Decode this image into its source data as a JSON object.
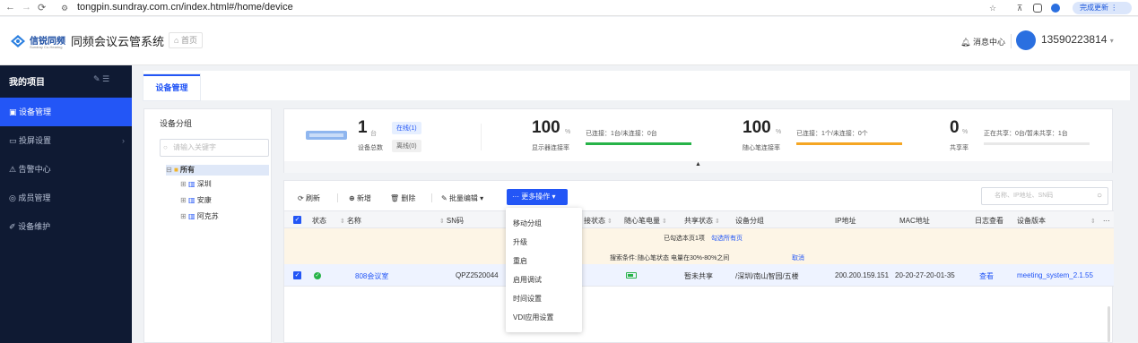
{
  "browser": {
    "url": "tongpin.sundray.com.cn/index.html#/home/device",
    "update_label": "完成更新"
  },
  "header": {
    "brand": "信锐同频",
    "brand_sub": "Sundray Co-Hearing",
    "system_title": "同频会议云管系统",
    "home_label": "首页",
    "message_center": "消息中心",
    "phone": "13590223814"
  },
  "sidebar": {
    "title": "我的项目",
    "items": [
      {
        "label": "设备管理",
        "icon": "device-icon"
      },
      {
        "label": "投屏设置",
        "icon": "screen-icon"
      },
      {
        "label": "告警中心",
        "icon": "bell-icon"
      },
      {
        "label": "成员管理",
        "icon": "member-icon"
      },
      {
        "label": "设备维护",
        "icon": "wrench-icon"
      }
    ]
  },
  "tabs": {
    "active": "设备管理"
  },
  "groups": {
    "title": "设备分组",
    "search_placeholder": "请输入关键字",
    "tree": {
      "root": "所有",
      "children": [
        "深圳",
        "安康",
        "阿克苏"
      ]
    }
  },
  "stats": {
    "device_count": "1",
    "device_unit": "台",
    "device_label": "设备总数",
    "online": "在线(1)",
    "offline": "离线(0)",
    "display": {
      "value": "100",
      "unit": "%",
      "label": "显示器连接率",
      "text": "已连接：1台/未连接：0台",
      "fill": 1.0,
      "color": "#27b348"
    },
    "pen": {
      "value": "100",
      "unit": "%",
      "label": "随心笔连接率",
      "text": "已连接：1个/未连接：0个",
      "fill": 1.0,
      "color": "#f5a623"
    },
    "share": {
      "value": "0",
      "unit": "%",
      "label": "共享率",
      "text": "正在共享：0台/暂未共享：1台",
      "fill": 0.0,
      "color": "#2356f6"
    }
  },
  "toolbar": {
    "refresh": "刷新",
    "add": "新增",
    "delete": "删除",
    "batch_edit": "批量编辑",
    "more_ops": "更多操作",
    "search_placeholder": "名称、IP地址、SN码"
  },
  "columns": [
    "状态",
    "名称",
    "SN码",
    "接状态",
    "随心笔电量",
    "共享状态",
    "设备分组",
    "IP地址",
    "MAC地址",
    "日志查看",
    "设备版本"
  ],
  "notice": {
    "selected_text": "已勾选本页1项",
    "select_all": "勾选所有页",
    "cond_label": "搜索条件:",
    "cond_text": "随心笔状态 电量在30%-80%之间",
    "cancel": "取消"
  },
  "rows": [
    {
      "name": "808会议室",
      "sn": "QPZ2520044",
      "share": "暂未共享",
      "group": "/深圳/南山智园/五楼",
      "ip": "200.200.159.151",
      "mac": "20-20-27-20-01-35",
      "log": "查看",
      "version": "meeting_system_2.1.55"
    }
  ],
  "more_menu": [
    "移动分组",
    "升级",
    "重启",
    "启用调试",
    "时间设置",
    "VDI应用设置"
  ]
}
